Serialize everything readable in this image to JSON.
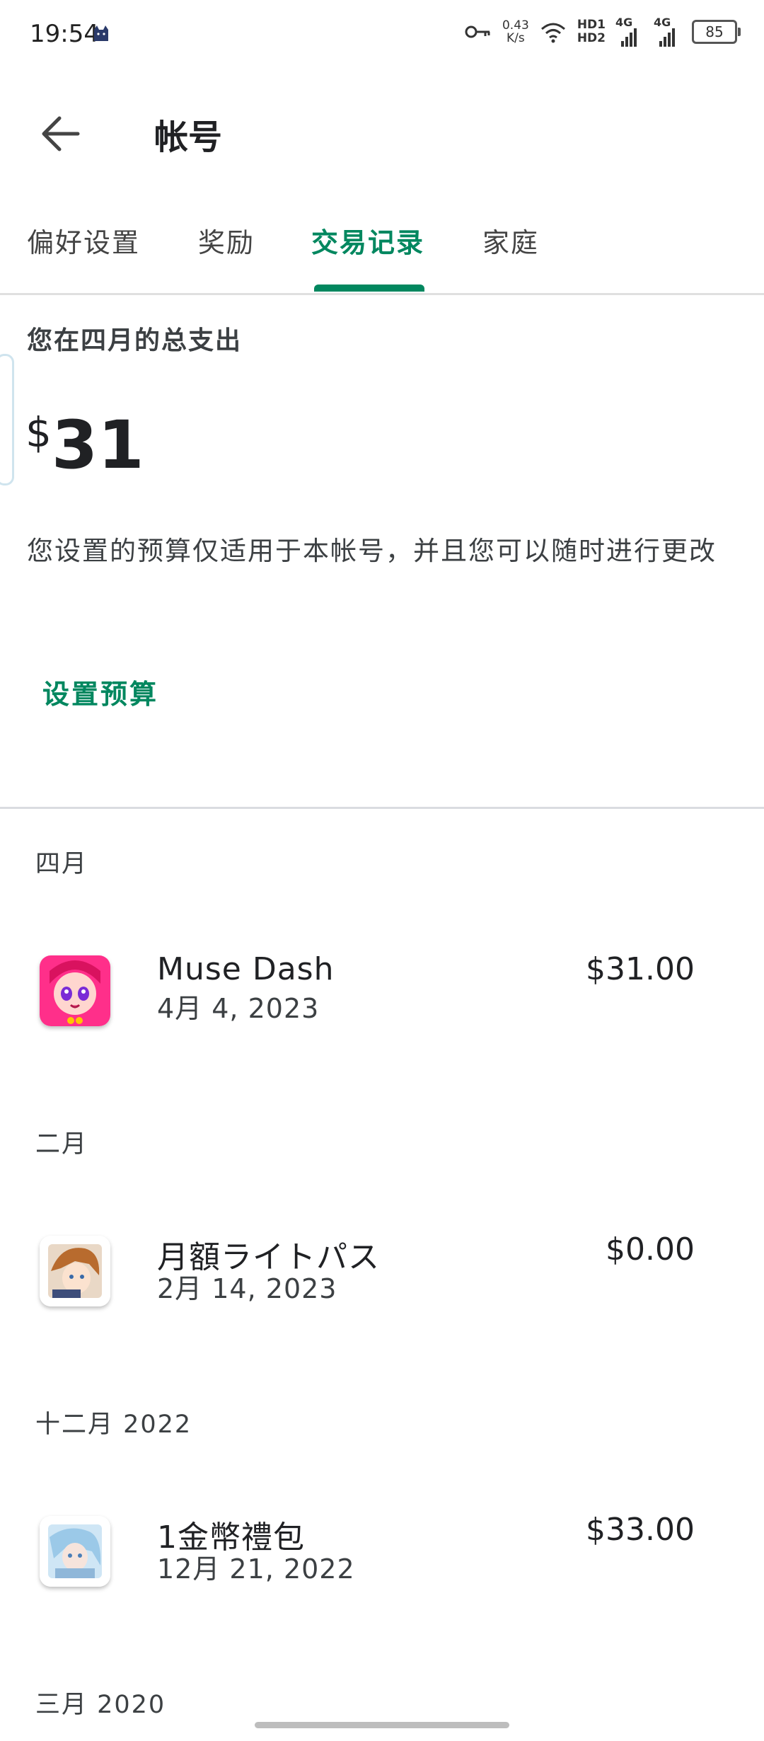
{
  "status_bar": {
    "time": "19:54",
    "net_speed_value": "0.43",
    "net_speed_unit": "K/s",
    "hd1": "HD1",
    "hd2": "HD2",
    "network_1": "4G",
    "network_2": "4G",
    "battery": "85"
  },
  "header": {
    "title": "帐号",
    "back_icon": "arrow-left-icon"
  },
  "tabs": [
    {
      "label": "偏好设置",
      "active": false
    },
    {
      "label": "奖励",
      "active": false
    },
    {
      "label": "交易记录",
      "active": true
    },
    {
      "label": "家庭",
      "active": false
    }
  ],
  "summary": {
    "label": "您在四月的总支出",
    "currency_symbol": "$",
    "amount": "31",
    "note": "您设置的预算仅适用于本帐号，并且您可以随时进行更改",
    "set_budget_label": "设置预算"
  },
  "groups": [
    {
      "month": "四月",
      "items": [
        {
          "name": "Muse Dash",
          "date": "4月 4, 2023",
          "amount": "$31.00"
        }
      ]
    },
    {
      "month": "二月",
      "items": [
        {
          "name": "月額ライトパス",
          "date": "2月 14, 2023",
          "amount": "$0.00"
        }
      ]
    },
    {
      "month": "十二月 2022",
      "items": [
        {
          "name": "1金幣禮包",
          "date": "12月 21, 2022",
          "amount": "$33.00"
        }
      ]
    },
    {
      "month": "三月 2020",
      "items": []
    }
  ],
  "colors": {
    "accent": "#01875f",
    "text_primary": "#202124",
    "text_secondary": "#3c4043",
    "divider": "#dadce0"
  }
}
